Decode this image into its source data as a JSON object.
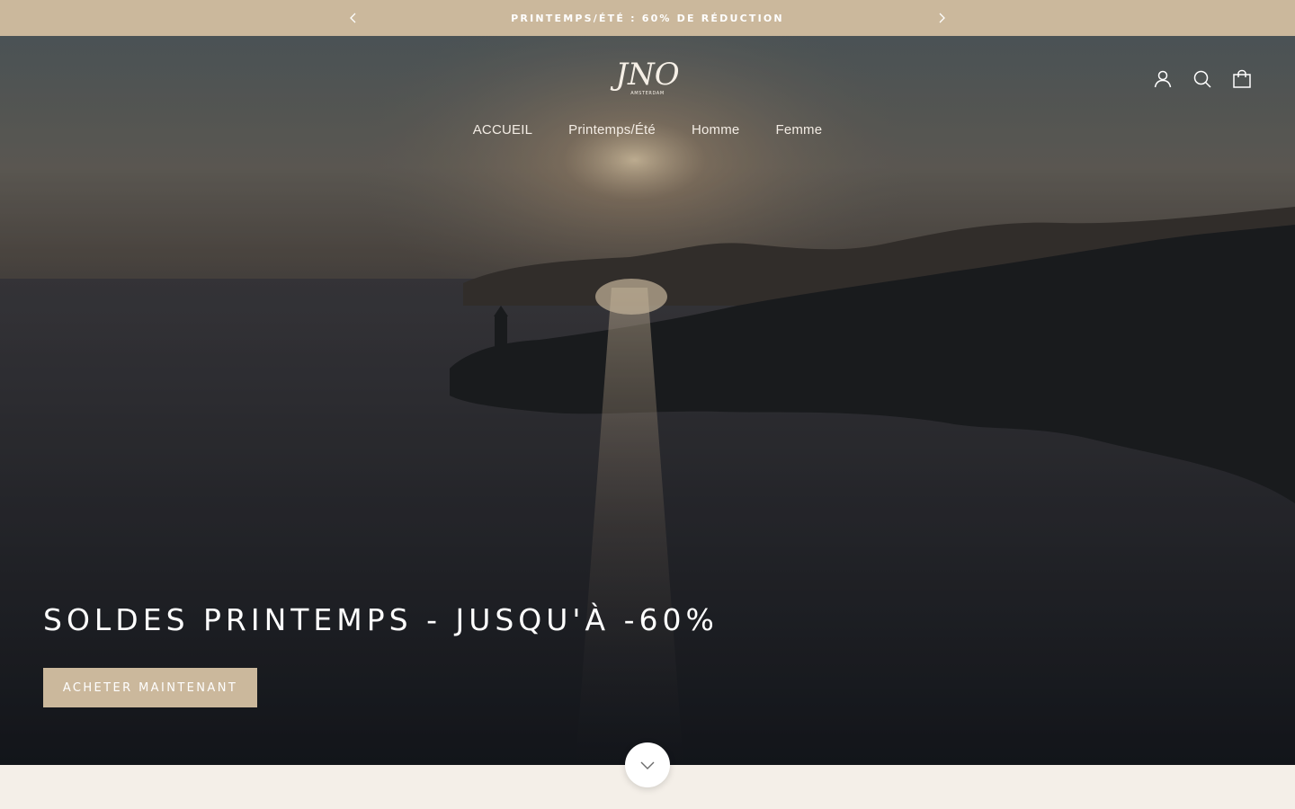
{
  "announcement": {
    "text": "PRINTEMPS/ÉTÉ : 60% DE RÉDUCTION",
    "prev_icon": "chevron-left-icon",
    "next_icon": "chevron-right-icon"
  },
  "header": {
    "logo_text": "JNO",
    "logo_subtext": "AMSTERDAM",
    "nav": [
      {
        "label": "ACCUEIL"
      },
      {
        "label": "Printemps/Été"
      },
      {
        "label": "Homme"
      },
      {
        "label": "Femme"
      }
    ],
    "icons": [
      "account-icon",
      "search-icon",
      "cart-icon"
    ]
  },
  "hero": {
    "title": "SOLDES PRINTEMPS - JUSQU'À -60%",
    "cta_label": "ACHETER MAINTENANT",
    "scroll_icon": "chevron-down-icon"
  },
  "colors": {
    "accent": "#cbb89c",
    "page_bg": "#f4efe8",
    "text_light": "#ffffff"
  }
}
